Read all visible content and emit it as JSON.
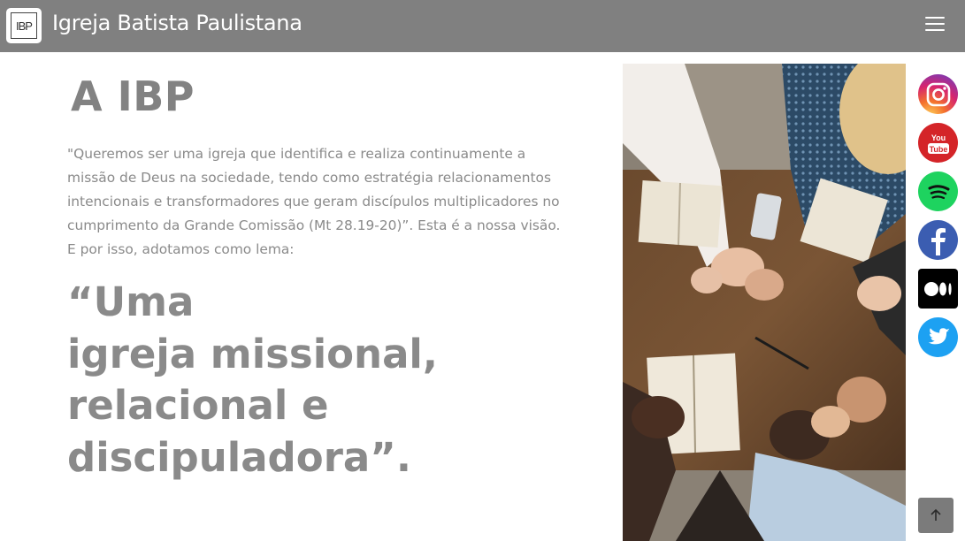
{
  "header": {
    "logo_text": "IBP",
    "site_title": "Igreja Batista Paulistana",
    "menu_icon": "hamburger-menu-icon"
  },
  "main": {
    "heading": "A IBP",
    "vision_text": "\"Queremos ser uma igreja que identifica e realiza continuamente a missão de Deus na sociedade, tendo como estratégia relacionamentos intencionais e transformadores que geram discípulos multiplicadores no cumprimento da Grande Comissão (Mt 28.19-20)”. Esta é a nossa visão. E por isso, adotamos como lema:",
    "motto_lines": [
      "“Uma",
      "igreja missional,",
      "relacional e",
      "discipuladora”."
    ]
  },
  "social": [
    {
      "name": "instagram-icon",
      "label": "Instagram"
    },
    {
      "name": "youtube-icon",
      "label": "YouTube",
      "text": "You Tube"
    },
    {
      "name": "spotify-icon",
      "label": "Spotify"
    },
    {
      "name": "facebook-icon",
      "label": "Facebook"
    },
    {
      "name": "medium-icon",
      "label": "Medium"
    },
    {
      "name": "twitter-icon",
      "label": "Twitter"
    }
  ],
  "back_to_top_icon": "arrow-up-icon",
  "colors": {
    "navbar": "#808080",
    "text_gray": "#8a8a8a"
  }
}
